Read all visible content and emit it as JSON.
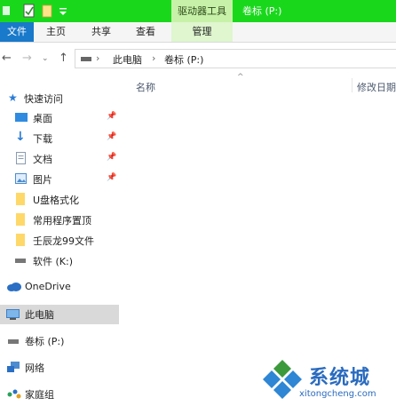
{
  "title_bar": {
    "context_tab_label": "驱动器工具",
    "window_title": "卷标 (P:)"
  },
  "ribbon": {
    "tabs": [
      "文件",
      "主页",
      "共享",
      "查看",
      "管理"
    ]
  },
  "address_bar": {
    "crumbs": [
      "此电脑",
      "卷标 (P:)"
    ]
  },
  "nav_pane": {
    "quick_access_label": "快速访问",
    "quick_items": [
      "桌面",
      "下载",
      "文档",
      "图片",
      "U盘格式化",
      "常用程序置顶",
      "壬辰龙99文件",
      "软件 (K:)"
    ],
    "onedrive_label": "OneDrive",
    "this_pc_label": "此电脑",
    "volume_label": "卷标 (P:)",
    "network_label": "网络",
    "homegroup_label": "家庭组"
  },
  "columns": {
    "name": "名称",
    "modified": "修改日期"
  },
  "watermark": {
    "brand": "系统城",
    "url": "xitongcheng.com"
  },
  "colors": {
    "title_bar": "#19d81c",
    "file_tab": "#1979ca",
    "selected_nav": "#d9d9d9"
  }
}
